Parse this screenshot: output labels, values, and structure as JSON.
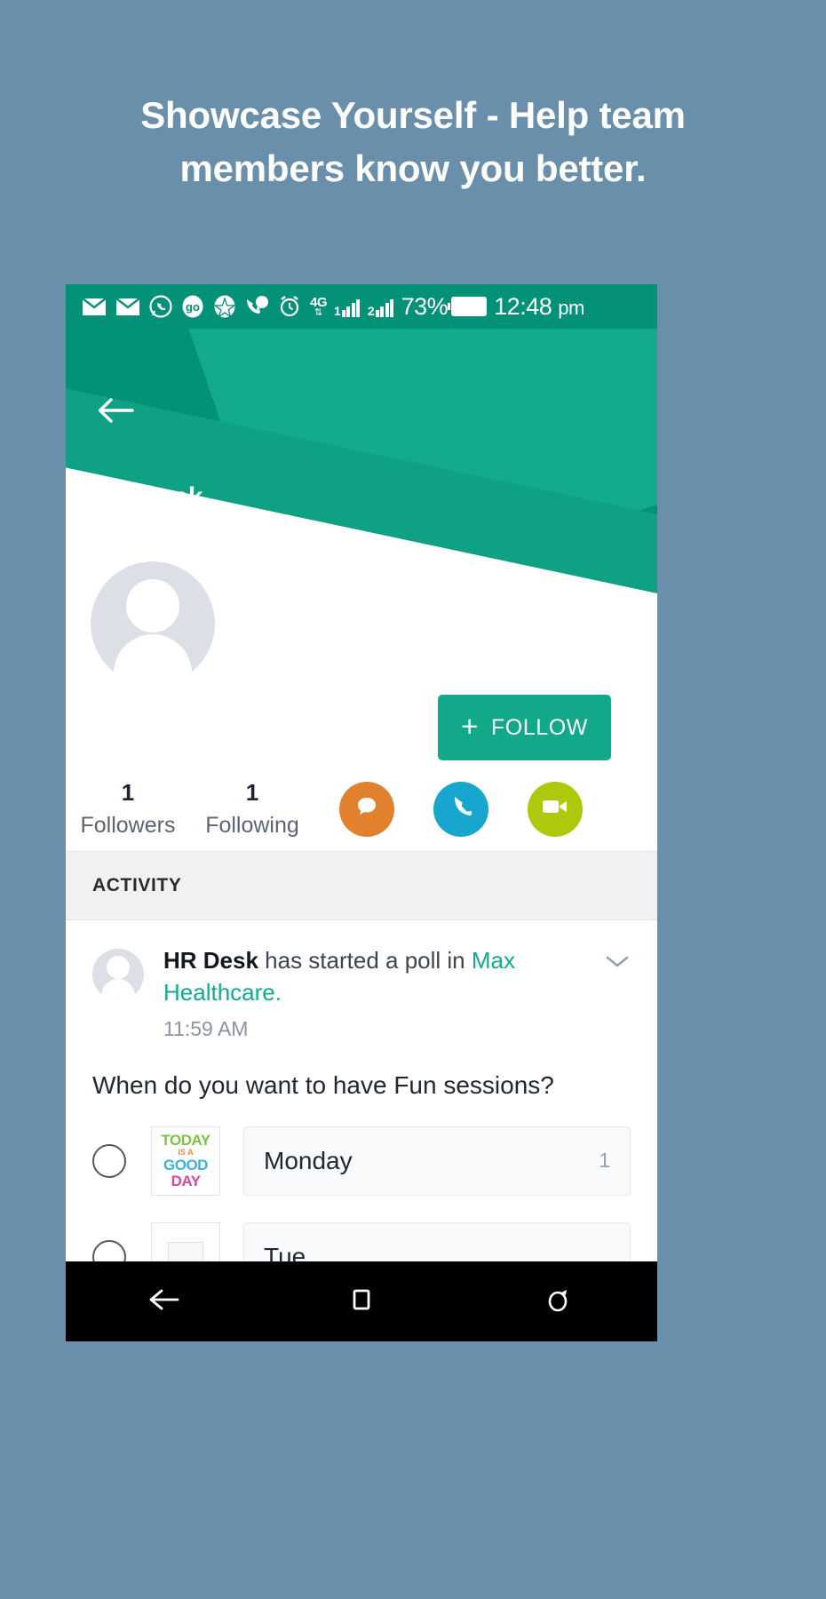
{
  "promo": {
    "headline": "Showcase Yourself - Help team members know you better."
  },
  "statusbar": {
    "icons": [
      "mail-icon",
      "mail-icon",
      "whatsapp-icon",
      "go-icon",
      "star-icon",
      "chat-call-icon",
      "alarm-icon"
    ],
    "network": {
      "label": "4G",
      "arrows": "⇅"
    },
    "sim1": "1",
    "sim2": "2",
    "battery_percent": "73%",
    "time": "12:48",
    "ampm": "pm"
  },
  "header": {
    "back_icon": "back-arrow-icon",
    "title": "HR Desk"
  },
  "profile": {
    "avatar": "profile-avatar",
    "follow_button": {
      "plus": "+",
      "label": "FOLLOW"
    },
    "stats": [
      {
        "num": "1",
        "label": "Followers"
      },
      {
        "num": "1",
        "label": "Following"
      }
    ],
    "actions": [
      {
        "name": "chat-icon",
        "color": "#e2812d"
      },
      {
        "name": "call-icon",
        "color": "#16a6ce"
      },
      {
        "name": "video-icon",
        "color": "#aec80b"
      }
    ]
  },
  "activity": {
    "section_title": "ACTIVITY",
    "post": {
      "actor": "HR Desk",
      "action": " has started a poll in ",
      "group": "Max Healthcare.",
      "time": "11:59 AM",
      "expand_icon": "chevron-down-icon"
    },
    "poll": {
      "question": "When do you want to have Fun sessions?",
      "options": [
        {
          "label": "Monday",
          "count": "1",
          "thumb": {
            "line1": "TODAY",
            "line2": "IS A",
            "line3": "GOOD",
            "line4": "DAY"
          }
        },
        {
          "label": "Tue",
          "count": "",
          "thumb": {
            "line1": "",
            "line2": "",
            "line3": "",
            "line4": ""
          }
        }
      ]
    }
  },
  "navbar": {
    "back": "android-back-icon",
    "home": "android-home-icon",
    "recents": "android-recents-icon"
  }
}
